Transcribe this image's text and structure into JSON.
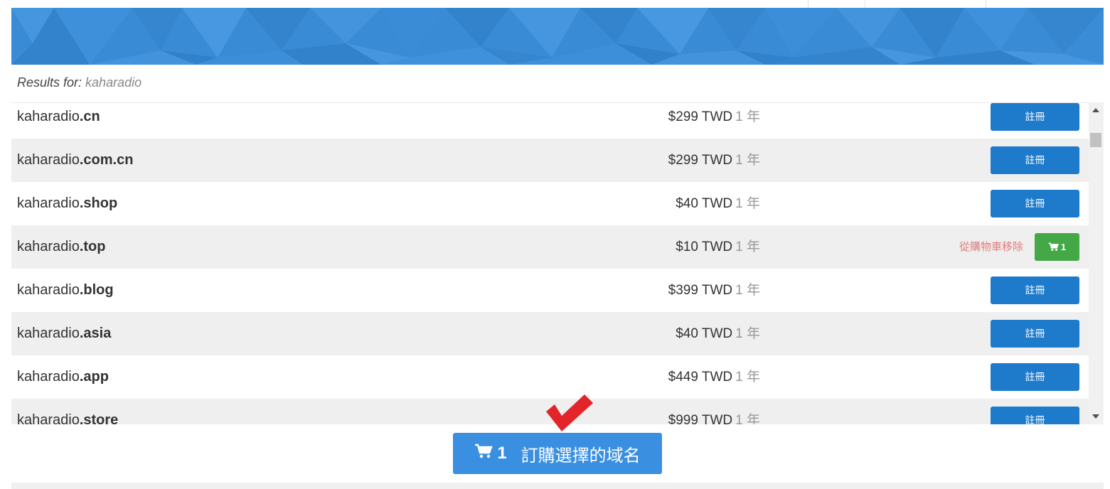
{
  "results": {
    "label": "Results for:",
    "query": "kaharadio"
  },
  "term": "1 年",
  "register_label": "註冊",
  "rows": [
    {
      "name": "kaharadio",
      "tld": ".cn",
      "price": "$299 TWD",
      "in_cart": false
    },
    {
      "name": "kaharadio",
      "tld": ".com.cn",
      "price": "$299 TWD",
      "in_cart": false
    },
    {
      "name": "kaharadio",
      "tld": ".shop",
      "price": "$40 TWD",
      "in_cart": false
    },
    {
      "name": "kaharadio",
      "tld": ".top",
      "price": "$10 TWD",
      "in_cart": true,
      "remove_label": "從購物車移除",
      "cart_count": "1"
    },
    {
      "name": "kaharadio",
      "tld": ".blog",
      "price": "$399 TWD",
      "in_cart": false
    },
    {
      "name": "kaharadio",
      "tld": ".asia",
      "price": "$40 TWD",
      "in_cart": false
    },
    {
      "name": "kaharadio",
      "tld": ".app",
      "price": "$449 TWD",
      "in_cart": false
    },
    {
      "name": "kaharadio",
      "tld": ".store",
      "price": "$999 TWD",
      "in_cart": false
    }
  ],
  "checkout": {
    "count": "1",
    "label": "訂購選擇的域名"
  },
  "colors": {
    "banner": "#3a8bd6",
    "register": "#1e7bcc",
    "in_cart": "#43a845",
    "remove": "#e07a7a",
    "checkout": "#3a8fe0",
    "checkmark": "#e3242b"
  },
  "icons": {
    "cart": "shopping-cart-icon",
    "check": "checkmark-icon"
  }
}
